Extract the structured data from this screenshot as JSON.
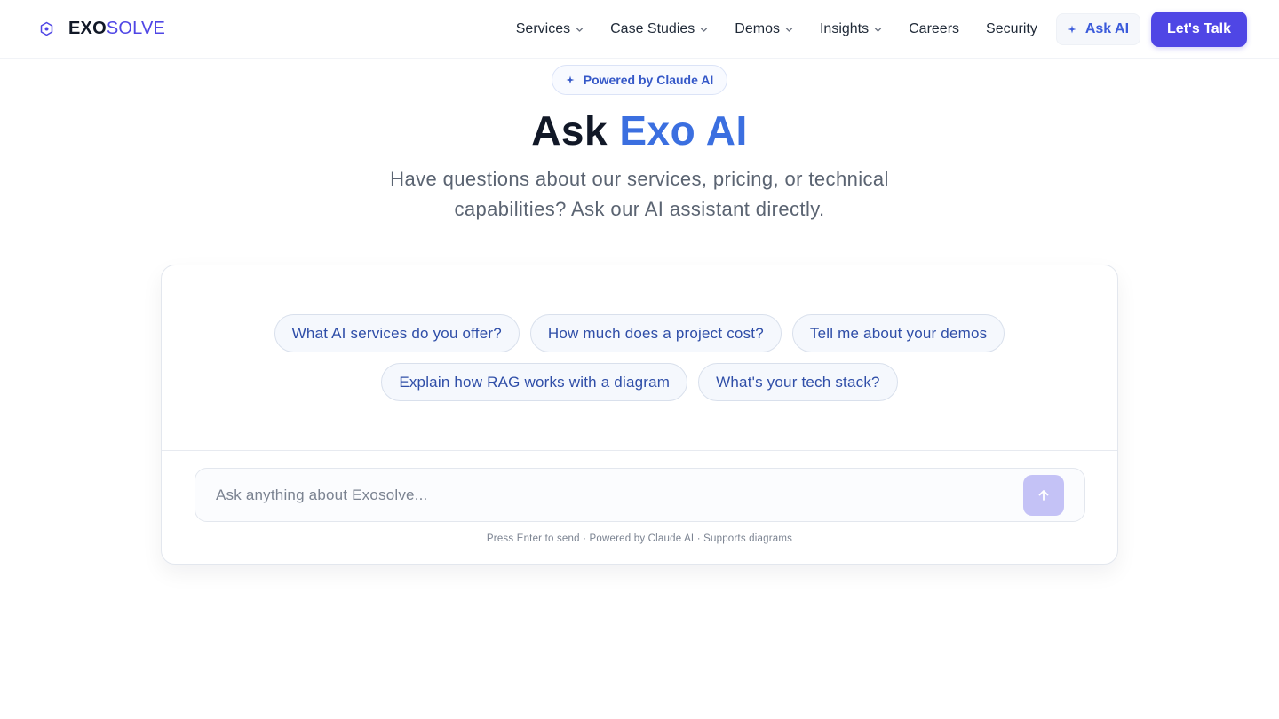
{
  "header": {
    "logo": {
      "part1": "EXO",
      "part2": "SOLVE"
    },
    "nav": [
      {
        "label": "Services",
        "has_dropdown": true
      },
      {
        "label": "Case Studies",
        "has_dropdown": true
      },
      {
        "label": "Demos",
        "has_dropdown": true
      },
      {
        "label": "Insights",
        "has_dropdown": true
      },
      {
        "label": "Careers",
        "has_dropdown": false
      },
      {
        "label": "Security",
        "has_dropdown": false
      }
    ],
    "ask_ai_label": "Ask AI",
    "cta_label": "Let's Talk"
  },
  "hero": {
    "badge": "Powered by Claude AI",
    "title_main": "Ask",
    "title_accent": "Exo AI",
    "subtitle": "Have questions about our services, pricing, or technical capabilities? Ask our AI assistant directly."
  },
  "chat": {
    "suggestions_row1": [
      "What AI services do you offer?",
      "How much does a project cost?",
      "Tell me about your demos"
    ],
    "suggestions_row2": [
      "Explain how RAG works with a diagram",
      "What's your tech stack?"
    ],
    "input_value": "",
    "input_placeholder": "Ask anything about Exosolve...",
    "hint": "Press Enter to send · Powered by Claude AI · Supports diagrams"
  },
  "icons": {
    "logo": "hexagon-icon",
    "dropdown": "chevron-down-icon",
    "sparkle": "sparkle-icon",
    "send": "arrow-up-icon"
  },
  "colors": {
    "brand": "#4f46e5",
    "accent": "#3b6fe0",
    "chip_text": "#2f4ea8",
    "send_button": "#c4c2f6"
  }
}
